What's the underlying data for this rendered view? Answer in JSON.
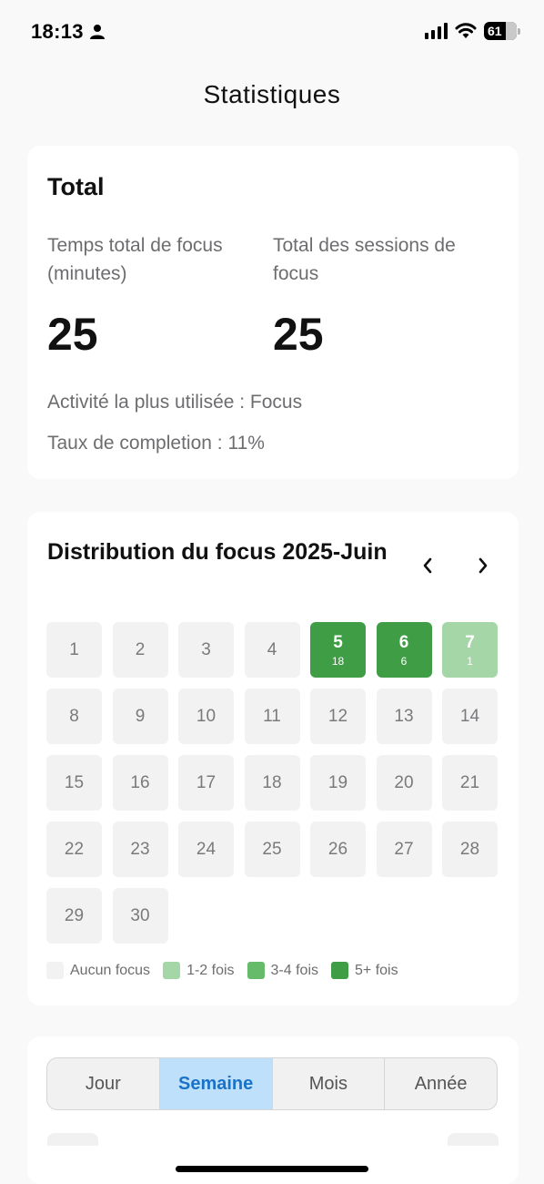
{
  "status_bar": {
    "time": "18:13",
    "battery_percent": "61",
    "icons": [
      "person-icon",
      "cellular-signal-icon",
      "wifi-icon",
      "battery-icon"
    ]
  },
  "page": {
    "title": "Statistiques"
  },
  "total": {
    "title": "Total",
    "focus_minutes_label": "Temps total de focus (minutes)",
    "focus_minutes_value": "25",
    "sessions_label": "Total des sessions de focus",
    "sessions_value": "25",
    "most_used": "Activité la plus utilisée : Focus",
    "completion_rate": "Taux de completion : 11%"
  },
  "distribution": {
    "title": "Distribution du focus 2025-Juin",
    "prev_icon": "chevron-left-icon",
    "next_icon": "chevron-right-icon",
    "days": [
      {
        "day": "1",
        "count": "",
        "level": 0
      },
      {
        "day": "2",
        "count": "",
        "level": 0
      },
      {
        "day": "3",
        "count": "",
        "level": 0
      },
      {
        "day": "4",
        "count": "",
        "level": 0
      },
      {
        "day": "5",
        "count": "18",
        "level": 3
      },
      {
        "day": "6",
        "count": "6",
        "level": 3
      },
      {
        "day": "7",
        "count": "1",
        "level": 1
      },
      {
        "day": "8",
        "count": "",
        "level": 0
      },
      {
        "day": "9",
        "count": "",
        "level": 0
      },
      {
        "day": "10",
        "count": "",
        "level": 0
      },
      {
        "day": "11",
        "count": "",
        "level": 0
      },
      {
        "day": "12",
        "count": "",
        "level": 0
      },
      {
        "day": "13",
        "count": "",
        "level": 0
      },
      {
        "day": "14",
        "count": "",
        "level": 0
      },
      {
        "day": "15",
        "count": "",
        "level": 0
      },
      {
        "day": "16",
        "count": "",
        "level": 0
      },
      {
        "day": "17",
        "count": "",
        "level": 0
      },
      {
        "day": "18",
        "count": "",
        "level": 0
      },
      {
        "day": "19",
        "count": "",
        "level": 0
      },
      {
        "day": "20",
        "count": "",
        "level": 0
      },
      {
        "day": "21",
        "count": "",
        "level": 0
      },
      {
        "day": "22",
        "count": "",
        "level": 0
      },
      {
        "day": "23",
        "count": "",
        "level": 0
      },
      {
        "day": "24",
        "count": "",
        "level": 0
      },
      {
        "day": "25",
        "count": "",
        "level": 0
      },
      {
        "day": "26",
        "count": "",
        "level": 0
      },
      {
        "day": "27",
        "count": "",
        "level": 0
      },
      {
        "day": "28",
        "count": "",
        "level": 0
      },
      {
        "day": "29",
        "count": "",
        "level": 0
      },
      {
        "day": "30",
        "count": "",
        "level": 0
      }
    ],
    "legend": [
      {
        "label": "Aucun focus",
        "color": "#f2f2f2"
      },
      {
        "label": "1-2 fois",
        "color": "#a5d6a7"
      },
      {
        "label": "3-4 fois",
        "color": "#66bb6a"
      },
      {
        "label": "5+ fois",
        "color": "#3f9e45"
      }
    ]
  },
  "period_tabs": {
    "items": [
      "Jour",
      "Semaine",
      "Mois",
      "Année"
    ],
    "selected": "Semaine"
  }
}
